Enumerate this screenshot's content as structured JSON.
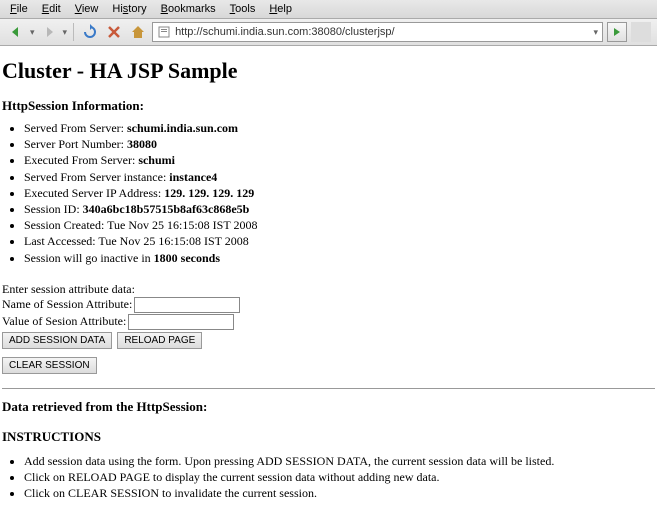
{
  "menubar": {
    "file": "File",
    "edit": "Edit",
    "view": "View",
    "history": "History",
    "bookmarks": "Bookmarks",
    "tools": "Tools",
    "help": "Help"
  },
  "toolbar": {
    "url": "http://schumi.india.sun.com:38080/clusterjsp/"
  },
  "page": {
    "title": "Cluster - HA JSP Sample",
    "section_head": "HttpSession Information:",
    "info": [
      {
        "label": "Served From Server: ",
        "value": "schumi.india.sun.com"
      },
      {
        "label": "Server Port Number: ",
        "value": "38080"
      },
      {
        "label": "Executed From Server: ",
        "value": "schumi"
      },
      {
        "label": "Served From Server instance: ",
        "value": "instance4"
      },
      {
        "label": "Executed Server IP Address: ",
        "value": "129. 129. 129. 129"
      },
      {
        "label": "Session ID: ",
        "value": "340a6bc18b57515b8af63c868e5b"
      },
      {
        "label": "Session Created: Tue Nov 25 16:15:08 IST 2008",
        "value": ""
      },
      {
        "label": "Last Accessed: Tue Nov 25 16:15:08 IST 2008",
        "value": ""
      },
      {
        "label": "Session will go inactive in ",
        "value": "1800 seconds"
      }
    ],
    "form": {
      "prompt": "Enter session attribute data:",
      "name_label": "Name of Session Attribute:",
      "value_label": "Value of Sesion Attribute:",
      "add_btn": "ADD SESSION DATA",
      "reload_btn": "RELOAD PAGE",
      "clear_btn": "CLEAR SESSION"
    },
    "retrieved_head": "Data retrieved from the HttpSession:",
    "instructions_head": "INSTRUCTIONS",
    "instructions": [
      "Add session data using the form. Upon pressing ADD SESSION DATA, the current session data will be listed.",
      "Click on RELOAD PAGE to display the current session data without adding new data.",
      "Click on CLEAR SESSION to invalidate the current session."
    ]
  }
}
